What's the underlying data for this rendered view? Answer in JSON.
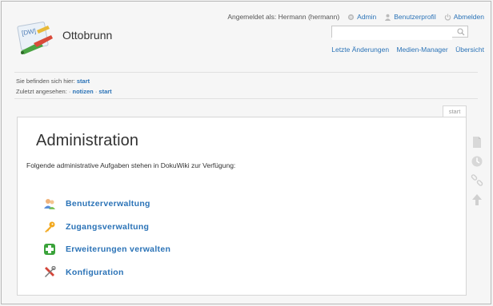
{
  "header": {
    "site_title": "Ottobrunn",
    "logo_text": "[DW]",
    "user_tools": {
      "logged_in_label": "Angemeldet als: Hermann (hermann)",
      "admin": "Admin",
      "profile": "Benutzerprofil",
      "logout": "Abmelden"
    },
    "search": {
      "value": "",
      "placeholder": ""
    },
    "site_tools": {
      "recent_changes": "Letzte Änderungen",
      "media_manager": "Medien-Manager",
      "sitemap": "Übersicht"
    }
  },
  "breadcrumbs": {
    "location_label": "Sie befinden sich hier:",
    "location_link": "start",
    "trace_label": "Zuletzt angesehen:",
    "trace_sep": "·",
    "trace_1": "notizen",
    "trace_2": "start"
  },
  "page": {
    "tab": "start",
    "title": "Administration",
    "intro": "Folgende administrative Aufgaben stehen in DokuWiki zur Verfügung:",
    "admin_items": [
      {
        "label": "Benutzerverwaltung",
        "icon": "users-icon"
      },
      {
        "label": "Zugangsverwaltung",
        "icon": "key-icon"
      },
      {
        "label": "Erweiterungen verwalten",
        "icon": "plugin-icon"
      },
      {
        "label": "Konfiguration",
        "icon": "tools-icon"
      }
    ]
  },
  "colors": {
    "link": "#2b73b7",
    "text": "#333333",
    "background": "#f6f6f6"
  }
}
